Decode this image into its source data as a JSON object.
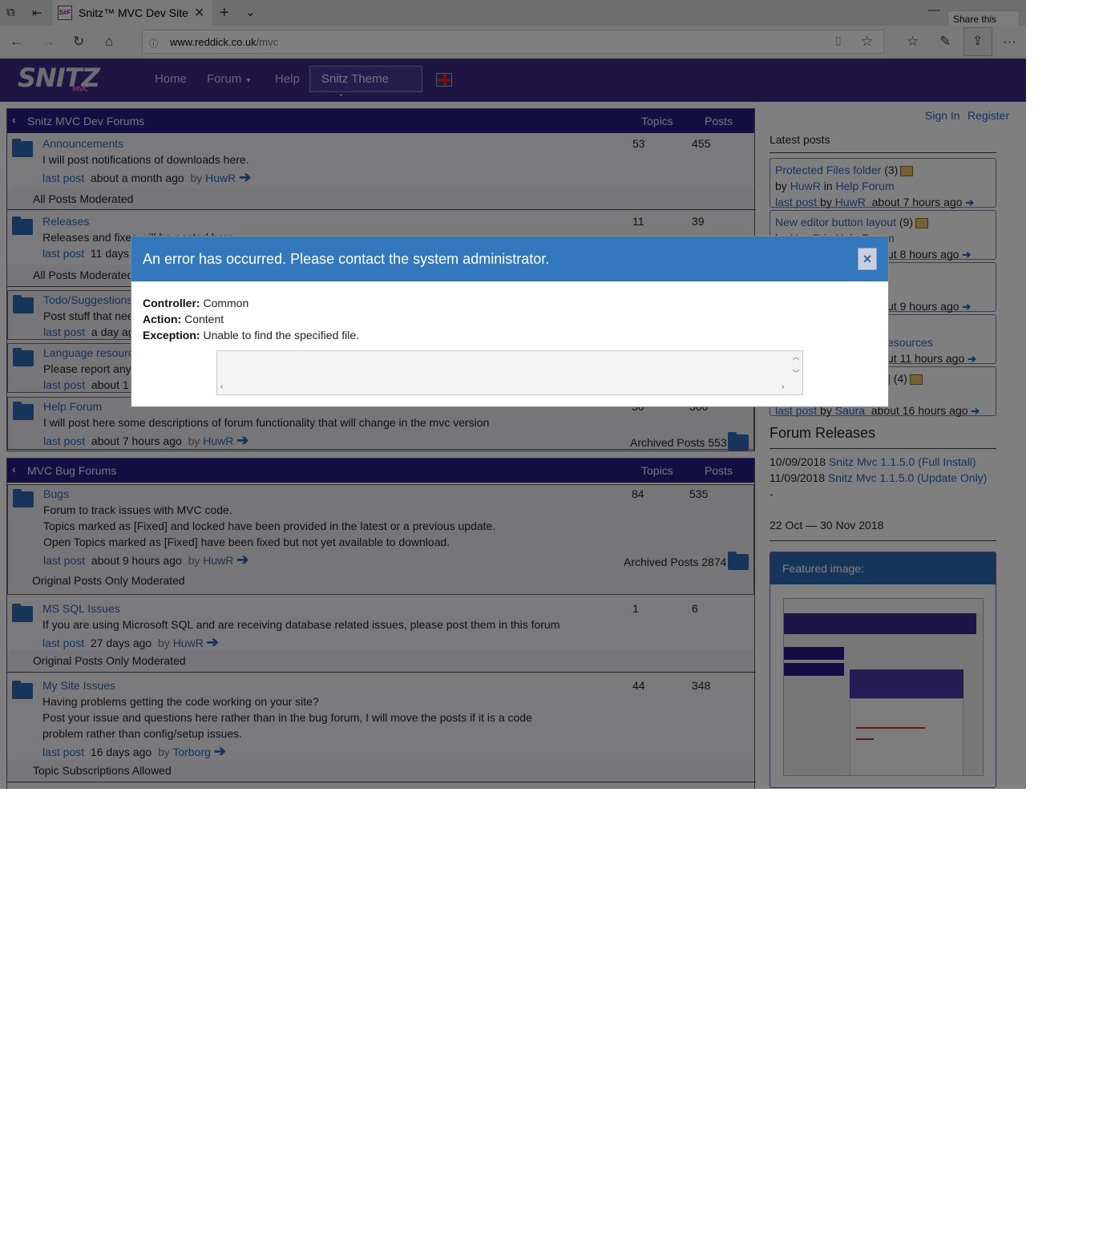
{
  "browser": {
    "tab_title": "Snitz™ MVC Dev Site",
    "favicon_text": "S#F",
    "url_host": "www.reddick.co.uk",
    "url_path": "/mvc",
    "share_tooltip": "Share this page"
  },
  "site": {
    "logo_text": "SNITZ",
    "logo_sub": "MVC",
    "nav": {
      "home": "Home",
      "forum": "Forum",
      "help": "Help",
      "theme": "Snitz Theme"
    }
  },
  "categories": [
    {
      "name": "Snitz MVC Dev Forums",
      "topics_label": "Topics",
      "posts_label": "Posts",
      "forums": [
        {
          "title": "Announcements",
          "desc": "I will post notifications of downloads here.",
          "lp_label": "last post",
          "lp_time": "about a month ago",
          "lp_by": "by",
          "lp_user": "HuwR",
          "topics": "53",
          "posts": "455",
          "moderation": "All Posts Moderated"
        },
        {
          "title": "Releases",
          "desc": "Releases and fixes will be posted here",
          "lp_label": "last post",
          "lp_time": "11 days",
          "topics": "11",
          "posts": "39",
          "moderation": "All Posts Moderated"
        },
        {
          "title": "Todo/Suggestions",
          "desc": "Post stuff that nee",
          "lp_label": "last post",
          "lp_time": "a day ag"
        },
        {
          "title": "Language resource",
          "desc": "Please report any",
          "lp_label": "last post",
          "lp_time": "about 1"
        },
        {
          "title": "Help Forum",
          "desc": "I will post here some descriptions of forum functionality that will change in the mvc version",
          "lp_label": "last post",
          "lp_time": "about 7 hours ago",
          "lp_by": "by",
          "lp_user": "HuwR",
          "topics": "50",
          "posts": "360",
          "archived": "Archived Posts 553"
        }
      ]
    },
    {
      "name": "MVC Bug Forums",
      "topics_label": "Topics",
      "posts_label": "Posts",
      "forums": [
        {
          "title": "Bugs",
          "desc1": "Forum to track issues with MVC code.",
          "desc2": "Topics marked as [Fixed] and locked have been provided in the latest or a previous update.",
          "desc3": "Open Topics marked as [Fixed] have been fixed but not yet available to download.",
          "lp_label": "last post",
          "lp_time": "about 9 hours ago",
          "lp_by": "by",
          "lp_user": "HuwR",
          "topics": "84",
          "posts": "535",
          "archived": "Archived Posts 2874",
          "moderation": "Original Posts Only Moderated"
        },
        {
          "title": "MS SQL Issues",
          "desc": "If you are using Microsoft SQL and are receiving database related issues, please post them in this forum",
          "lp_label": "last post",
          "lp_time": "27 days ago",
          "lp_by": "by",
          "lp_user": "HuwR",
          "topics": "1",
          "posts": "6",
          "moderation": "Original Posts Only Moderated"
        },
        {
          "title": "My Site Issues",
          "desc1": "Having problems getting the code working on your site?",
          "desc2": "Post your issue and questions here rather than in the bug forum, I will move the posts if it is a code",
          "desc3": "problem rather than config/setup issues.",
          "lp_label": "last post",
          "lp_time": "16 days ago",
          "lp_by": "by",
          "lp_user": "Torborg",
          "topics": "44",
          "posts": "348",
          "moderation": "Topic Subscriptions Allowed"
        }
      ]
    }
  ],
  "sidebar": {
    "sign_in": "Sign In",
    "register": "Register",
    "latest_title": "Latest posts",
    "latest": [
      {
        "topic": "Protected Files folder",
        "count": "(3)",
        "by": "by",
        "author": "HuwR",
        "in": "in",
        "forum": "Help Forum",
        "lp_label": "last post",
        "lp_by": "by",
        "lp_user": "HuwR",
        "time": "about 7 hours ago"
      },
      {
        "topic": "New editor button layout",
        "count": "(9)",
        "by": "by",
        "author": "HuwR",
        "in": "in",
        "forum": "Help Forum",
        "time": "ut 8 hours ago"
      },
      {
        "time": "ut 9 hours ago"
      },
      {
        "forum": "esources",
        "time": "ut 11 hours ago"
      },
      {
        "topic": "]",
        "count": "(4)",
        "lp_label": "last post",
        "lp_by": "by",
        "lp_user": "Saura",
        "time": "about 16 hours ago"
      }
    ],
    "releases_title": "Forum Releases",
    "releases": [
      {
        "date": "10/09/2018",
        "name": "Snitz Mvc 1.1.5.0 (Full Install)"
      },
      {
        "date": "11/09/2018",
        "name": "Snitz Mvc 1.1.5.0 (Update Only)"
      }
    ],
    "dash": "-",
    "date_range": "22 Oct — 30 Nov 2018",
    "featured_title": "Featured image:"
  },
  "modal": {
    "title": "An error has occurred. Please contact the system administrator.",
    "controller_label": "Controller:",
    "controller_value": "Common",
    "action_label": "Action:",
    "action_value": "Content",
    "exception_label": "Exception:",
    "exception_value": "Unable to find the specified file.",
    "close": "×"
  }
}
